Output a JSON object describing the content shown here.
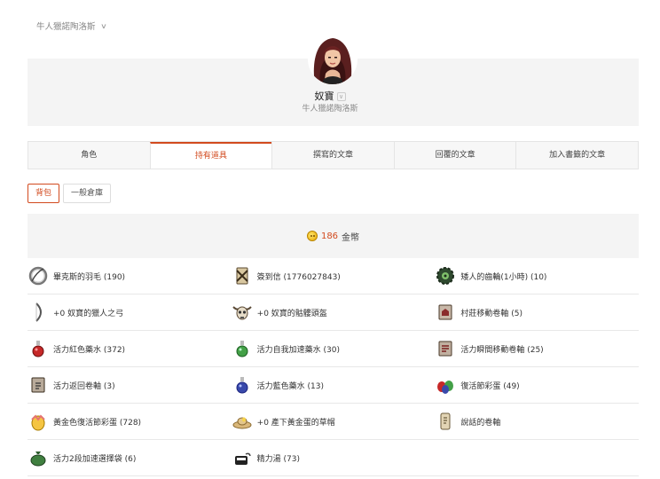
{
  "header": {
    "server": "牛人獵諾陶洛斯"
  },
  "character": {
    "name": "奴寶",
    "server": "牛人獵諾陶洛斯"
  },
  "tabs": [
    {
      "label": "角色"
    },
    {
      "label": "持有道具"
    },
    {
      "label": "撰寫的文章"
    },
    {
      "label": "回覆的文章"
    },
    {
      "label": "加入書籤的文章"
    }
  ],
  "active_tab": "持有道具",
  "subtabs": [
    {
      "label": "背包"
    },
    {
      "label": "一般倉庫"
    }
  ],
  "gold": {
    "amount": "186",
    "unit": "金幣"
  },
  "items": [
    {
      "label": "畢克斯的羽毛 (190)",
      "icon": "feather-ring-icon"
    },
    {
      "label": "簽到信 (1776027843)",
      "icon": "signin-letter-icon"
    },
    {
      "label": "矮人的齒輪(1小時) (10)",
      "icon": "dwarf-gear-icon"
    },
    {
      "label": "+0 奴寶的獵人之弓",
      "icon": "bow-icon"
    },
    {
      "label": "+0 奴寶的骷髏頭盔",
      "icon": "skull-helmet-icon"
    },
    {
      "label": "村莊移動卷軸 (5)",
      "icon": "village-scroll-icon"
    },
    {
      "label": "活力紅色藥水 (372)",
      "icon": "red-potion-icon"
    },
    {
      "label": "活力自我加速藥水 (30)",
      "icon": "green-potion-icon"
    },
    {
      "label": "活力瞬間移動卷軸 (25)",
      "icon": "teleport-scroll-icon"
    },
    {
      "label": "活力返回卷軸 (3)",
      "icon": "return-scroll-icon"
    },
    {
      "label": "活力藍色藥水 (13)",
      "icon": "blue-potion-icon"
    },
    {
      "label": "復活節彩蛋 (49)",
      "icon": "easter-eggs-icon"
    },
    {
      "label": "黃金色復活節彩蛋 (728)",
      "icon": "golden-egg-icon"
    },
    {
      "label": "+0 產下黃金蛋的草帽",
      "icon": "straw-hat-icon"
    },
    {
      "label": "說話的卷軸",
      "icon": "talking-scroll-icon"
    },
    {
      "label": "活力2段加速選擇袋 (6)",
      "icon": "green-bag-icon"
    },
    {
      "label": "精力湯 (73)",
      "icon": "stamina-soup-icon"
    }
  ]
}
